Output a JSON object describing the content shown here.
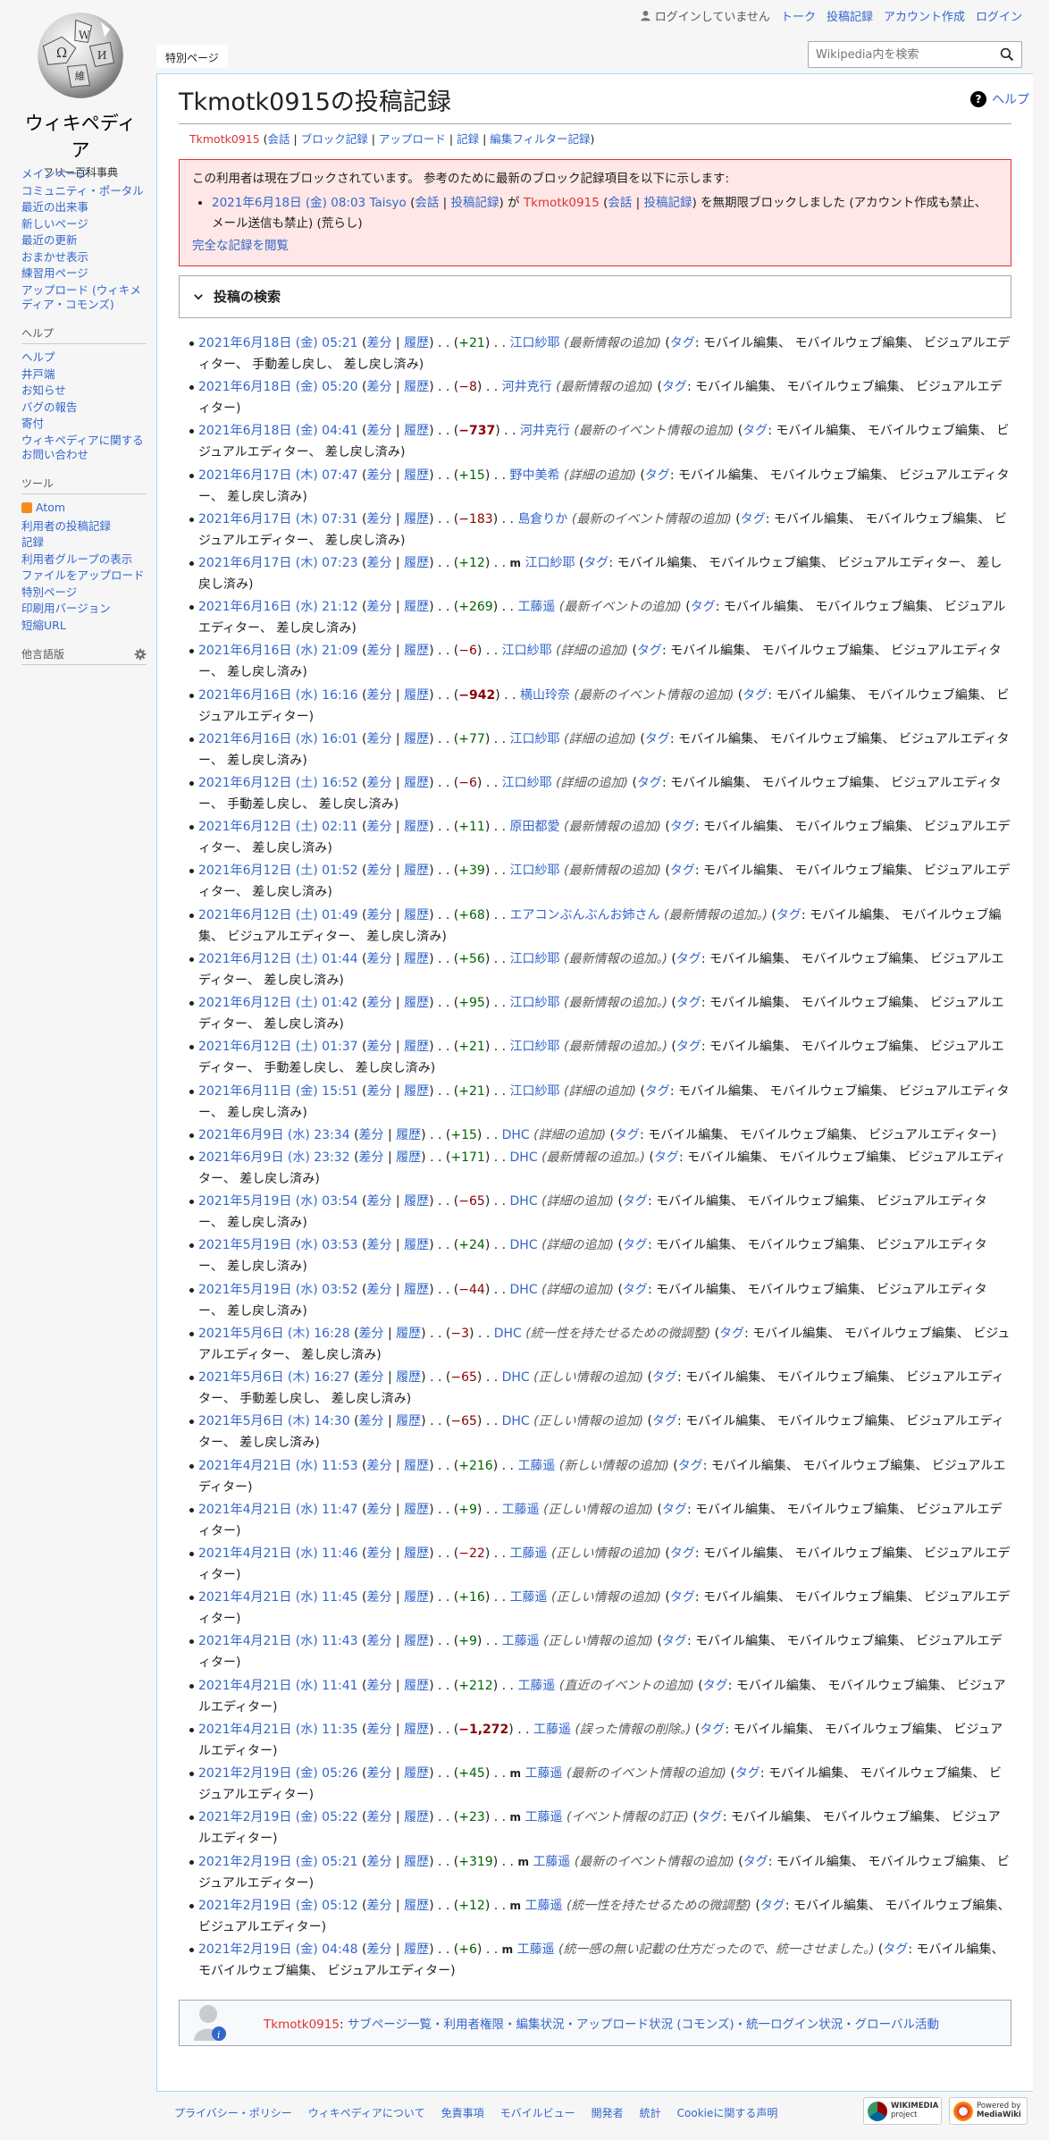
{
  "logo": {
    "wordmark": "ウィキペディア",
    "tagline": "フリー百科事典"
  },
  "personal": {
    "not_logged_in": "ログインしていません",
    "links": [
      "トーク",
      "投稿記録",
      "アカウント作成",
      "ログイン"
    ]
  },
  "tabs": {
    "special": "特別ページ"
  },
  "search": {
    "placeholder": "Wikipedia内を検索"
  },
  "sidebar": {
    "nav": [
      "メインページ",
      "コミュニティ・ポータル",
      "最近の出来事",
      "新しいページ",
      "最近の更新",
      "おまかせ表示",
      "練習用ページ",
      "アップロード (ウィキメディア・コモンズ)"
    ],
    "help_heading": "ヘルプ",
    "help": [
      "ヘルプ",
      "井戸端",
      "お知らせ",
      "バグの報告",
      "寄付",
      "ウィキペディアに関するお問い合わせ"
    ],
    "tools_heading": "ツール",
    "tools": [
      "Atom",
      "利用者の投稿記録",
      "記録",
      "利用者グループの表示",
      "ファイルをアップロード",
      "特別ページ",
      "印刷用バージョン",
      "短縮URL"
    ],
    "lang_heading": "他言語版"
  },
  "page": {
    "help": "ヘルプ",
    "title": "Tkmotk0915の投稿記録",
    "subtitle": {
      "user": "Tkmotk0915",
      "links": [
        "会話",
        "ブロック記録",
        "アップロード",
        "記録",
        "編集フィルター記録"
      ]
    }
  },
  "block": {
    "notice": "この利用者は現在ブロックされています。 参考のために最新のブロック記録項目を以下に示します:",
    "entry": {
      "time": "2021年6月18日 (金) 08:03",
      "admin": "Taisyo",
      "talk": "会話",
      "contribs": "投稿記録",
      "mid": "が",
      "target": "Tkmotk0915",
      "tail": "を無期限ブロックしました (アカウント作成も禁止、メール送信も禁止) (荒らし)"
    },
    "full_log": "完全な記録を閲覧"
  },
  "searchbox": {
    "title": "投稿の検索"
  },
  "labels": {
    "diff": "差分",
    "hist": "履歴",
    "tag": "タグ",
    "minor": "m"
  },
  "contribs": [
    {
      "time": "2021年6月18日 (金) 05:21",
      "size": "+21",
      "big": false,
      "minor": false,
      "page": "江口紗耶",
      "summary": "最新情報の追加",
      "tags": "モバイル編集、 モバイルウェブ編集、 ビジュアルエディター、 手動差し戻し、 差し戻し済み"
    },
    {
      "time": "2021年6月18日 (金) 05:20",
      "size": "−8",
      "big": false,
      "minor": false,
      "page": "河井克行",
      "summary": "最新情報の追加",
      "tags": "モバイル編集、 モバイルウェブ編集、 ビジュアルエディター"
    },
    {
      "time": "2021年6月18日 (金) 04:41",
      "size": "−737",
      "big": true,
      "minor": false,
      "page": "河井克行",
      "summary": "最新のイベント情報の追加",
      "tags": "モバイル編集、 モバイルウェブ編集、 ビジュアルエディター、 差し戻し済み"
    },
    {
      "time": "2021年6月17日 (木) 07:47",
      "size": "+15",
      "big": false,
      "minor": false,
      "page": "野中美希",
      "summary": "詳細の追加",
      "tags": "モバイル編集、 モバイルウェブ編集、 ビジュアルエディター、 差し戻し済み"
    },
    {
      "time": "2021年6月17日 (木) 07:31",
      "size": "−183",
      "big": false,
      "minor": false,
      "page": "島倉りか",
      "summary": "最新のイベント情報の追加",
      "tags": "モバイル編集、 モバイルウェブ編集、 ビジュアルエディター、 差し戻し済み"
    },
    {
      "time": "2021年6月17日 (木) 07:23",
      "size": "+12",
      "big": false,
      "minor": true,
      "page": "江口紗耶",
      "summary": "",
      "tags": "モバイル編集、 モバイルウェブ編集、 ビジュアルエディター、 差し戻し済み"
    },
    {
      "time": "2021年6月16日 (水) 21:12",
      "size": "+269",
      "big": false,
      "minor": false,
      "page": "工藤遥",
      "summary": "最新イベントの追加",
      "tags": "モバイル編集、 モバイルウェブ編集、 ビジュアルエディター、 差し戻し済み"
    },
    {
      "time": "2021年6月16日 (水) 21:09",
      "size": "−6",
      "big": false,
      "minor": false,
      "page": "江口紗耶",
      "summary": "詳細の追加",
      "tags": "モバイル編集、 モバイルウェブ編集、 ビジュアルエディター、 差し戻し済み"
    },
    {
      "time": "2021年6月16日 (水) 16:16",
      "size": "−942",
      "big": true,
      "minor": false,
      "page": "横山玲奈",
      "summary": "最新のイベント情報の追加",
      "tags": "モバイル編集、 モバイルウェブ編集、 ビジュアルエディター"
    },
    {
      "time": "2021年6月16日 (水) 16:01",
      "size": "+77",
      "big": false,
      "minor": false,
      "page": "江口紗耶",
      "summary": "詳細の追加",
      "tags": "モバイル編集、 モバイルウェブ編集、 ビジュアルエディター、 差し戻し済み"
    },
    {
      "time": "2021年6月12日 (土) 16:52",
      "size": "−6",
      "big": false,
      "minor": false,
      "page": "江口紗耶",
      "summary": "詳細の追加",
      "tags": "モバイル編集、 モバイルウェブ編集、 ビジュアルエディター、 手動差し戻し、 差し戻し済み"
    },
    {
      "time": "2021年6月12日 (土) 02:11",
      "size": "+11",
      "big": false,
      "minor": false,
      "page": "原田都愛",
      "summary": "最新情報の追加",
      "tags": "モバイル編集、 モバイルウェブ編集、 ビジュアルエディター、 差し戻し済み"
    },
    {
      "time": "2021年6月12日 (土) 01:52",
      "size": "+39",
      "big": false,
      "minor": false,
      "page": "江口紗耶",
      "summary": "最新情報の追加",
      "tags": "モバイル編集、 モバイルウェブ編集、 ビジュアルエディター、 差し戻し済み"
    },
    {
      "time": "2021年6月12日 (土) 01:49",
      "size": "+68",
      "big": false,
      "minor": false,
      "page": "エアコンぶんぶんお姉さん",
      "summary": "最新情報の追加。",
      "tags": "モバイル編集、 モバイルウェブ編集、 ビジュアルエディター、 差し戻し済み"
    },
    {
      "time": "2021年6月12日 (土) 01:44",
      "size": "+56",
      "big": false,
      "minor": false,
      "page": "江口紗耶",
      "summary": "最新情報の追加。",
      "tags": "モバイル編集、 モバイルウェブ編集、 ビジュアルエディター、 差し戻し済み"
    },
    {
      "time": "2021年6月12日 (土) 01:42",
      "size": "+95",
      "big": false,
      "minor": false,
      "page": "江口紗耶",
      "summary": "最新情報の追加。",
      "tags": "モバイル編集、 モバイルウェブ編集、 ビジュアルエディター、 差し戻し済み"
    },
    {
      "time": "2021年6月12日 (土) 01:37",
      "size": "+21",
      "big": false,
      "minor": false,
      "page": "江口紗耶",
      "summary": "最新情報の追加。",
      "tags": "モバイル編集、 モバイルウェブ編集、 ビジュアルエディター、 手動差し戻し、 差し戻し済み"
    },
    {
      "time": "2021年6月11日 (金) 15:51",
      "size": "+21",
      "big": false,
      "minor": false,
      "page": "江口紗耶",
      "summary": "詳細の追加",
      "tags": "モバイル編集、 モバイルウェブ編集、 ビジュアルエディター、 差し戻し済み"
    },
    {
      "time": "2021年6月9日 (水) 23:34",
      "size": "+15",
      "big": false,
      "minor": false,
      "page": "DHC",
      "summary": "詳細の追加",
      "tags": "モバイル編集、 モバイルウェブ編集、 ビジュアルエディター"
    },
    {
      "time": "2021年6月9日 (水) 23:32",
      "size": "+171",
      "big": false,
      "minor": false,
      "page": "DHC",
      "summary": "最新情報の追加。",
      "tags": "モバイル編集、 モバイルウェブ編集、 ビジュアルエディター、 差し戻し済み"
    },
    {
      "time": "2021年5月19日 (水) 03:54",
      "size": "−65",
      "big": false,
      "minor": false,
      "page": "DHC",
      "summary": "詳細の追加",
      "tags": "モバイル編集、 モバイルウェブ編集、 ビジュアルエディター、 差し戻し済み"
    },
    {
      "time": "2021年5月19日 (水) 03:53",
      "size": "+24",
      "big": false,
      "minor": false,
      "page": "DHC",
      "summary": "詳細の追加",
      "tags": "モバイル編集、 モバイルウェブ編集、 ビジュアルエディター、 差し戻し済み"
    },
    {
      "time": "2021年5月19日 (水) 03:52",
      "size": "−44",
      "big": false,
      "minor": false,
      "page": "DHC",
      "summary": "詳細の追加",
      "tags": "モバイル編集、 モバイルウェブ編集、 ビジュアルエディター、 差し戻し済み"
    },
    {
      "time": "2021年5月6日 (木) 16:28",
      "size": "−3",
      "big": false,
      "minor": false,
      "page": "DHC",
      "summary": "統一性を持たせるための微調整",
      "tags": "モバイル編集、 モバイルウェブ編集、 ビジュアルエディター、 差し戻し済み"
    },
    {
      "time": "2021年5月6日 (木) 16:27",
      "size": "−65",
      "big": false,
      "minor": false,
      "page": "DHC",
      "summary": "正しい情報の追加",
      "tags": "モバイル編集、 モバイルウェブ編集、 ビジュアルエディター、 手動差し戻し、 差し戻し済み"
    },
    {
      "time": "2021年5月6日 (木) 14:30",
      "size": "−65",
      "big": false,
      "minor": false,
      "page": "DHC",
      "summary": "正しい情報の追加",
      "tags": "モバイル編集、 モバイルウェブ編集、 ビジュアルエディター、 差し戻し済み"
    },
    {
      "time": "2021年4月21日 (水) 11:53",
      "size": "+216",
      "big": false,
      "minor": false,
      "page": "工藤遥",
      "summary": "新しい情報の追加",
      "tags": "モバイル編集、 モバイルウェブ編集、 ビジュアルエディター"
    },
    {
      "time": "2021年4月21日 (水) 11:47",
      "size": "+9",
      "big": false,
      "minor": false,
      "page": "工藤遥",
      "summary": "正しい情報の追加",
      "tags": "モバイル編集、 モバイルウェブ編集、 ビジュアルエディター"
    },
    {
      "time": "2021年4月21日 (水) 11:46",
      "size": "−22",
      "big": false,
      "minor": false,
      "page": "工藤遥",
      "summary": "正しい情報の追加",
      "tags": "モバイル編集、 モバイルウェブ編集、 ビジュアルエディター"
    },
    {
      "time": "2021年4月21日 (水) 11:45",
      "size": "+16",
      "big": false,
      "minor": false,
      "page": "工藤遥",
      "summary": "正しい情報の追加",
      "tags": "モバイル編集、 モバイルウェブ編集、 ビジュアルエディター"
    },
    {
      "time": "2021年4月21日 (水) 11:43",
      "size": "+9",
      "big": false,
      "minor": false,
      "page": "工藤遥",
      "summary": "正しい情報の追加",
      "tags": "モバイル編集、 モバイルウェブ編集、 ビジュアルエディター"
    },
    {
      "time": "2021年4月21日 (水) 11:41",
      "size": "+212",
      "big": false,
      "minor": false,
      "page": "工藤遥",
      "summary": "直近のイベントの追加",
      "tags": "モバイル編集、 モバイルウェブ編集、 ビジュアルエディター"
    },
    {
      "time": "2021年4月21日 (水) 11:35",
      "size": "−1,272",
      "big": true,
      "minor": false,
      "page": "工藤遥",
      "summary": "誤った情報の削除。",
      "tags": "モバイル編集、 モバイルウェブ編集、 ビジュアルエディター"
    },
    {
      "time": "2021年2月19日 (金) 05:26",
      "size": "+45",
      "big": false,
      "minor": true,
      "page": "工藤遥",
      "summary": "最新のイベント情報の追加",
      "tags": "モバイル編集、 モバイルウェブ編集、 ビジュアルエディター"
    },
    {
      "time": "2021年2月19日 (金) 05:22",
      "size": "+23",
      "big": false,
      "minor": true,
      "page": "工藤遥",
      "summary": "イベント情報の訂正",
      "tags": "モバイル編集、 モバイルウェブ編集、 ビジュアルエディター"
    },
    {
      "time": "2021年2月19日 (金) 05:21",
      "size": "+319",
      "big": false,
      "minor": true,
      "page": "工藤遥",
      "summary": "最新のイベント情報の追加",
      "tags": "モバイル編集、 モバイルウェブ編集、 ビジュアルエディター"
    },
    {
      "time": "2021年2月19日 (金) 05:12",
      "size": "+12",
      "big": false,
      "minor": true,
      "page": "工藤遥",
      "summary": "統一性を持たせるための微調整",
      "tags": "モバイル編集、 モバイルウェブ編集、 ビジュアルエディター"
    },
    {
      "time": "2021年2月19日 (金) 04:48",
      "size": "+6",
      "big": false,
      "minor": true,
      "page": "工藤遥",
      "summary": "統一感の無い記載の仕方だったので、統一させました。",
      "tags": "モバイル編集、 モバイルウェブ編集、 ビジュアルエディター"
    }
  ],
  "footerbox": {
    "user": "Tkmotk0915",
    "colon": ":",
    "links": "サブページ一覧・利用者権限・編集状況・アップロード状況 (コモンズ)・統一ログイン状況・グローバル活動"
  },
  "footer": [
    "プライバシー・ポリシー",
    "ウィキペディアについて",
    "免責事項",
    "モバイルビュー",
    "開発者",
    "統計",
    "Cookieに関する声明"
  ],
  "badges": {
    "wikimedia": [
      "WIKIMEDIA",
      "project"
    ],
    "mediawiki": [
      "Powered by",
      "MediaWiki"
    ]
  },
  "colors": {
    "link": "#3366cc",
    "redlink": "#dd3333",
    "positive": "#006400",
    "negative": "#8b0000",
    "block_bg": "#fee7e6"
  }
}
